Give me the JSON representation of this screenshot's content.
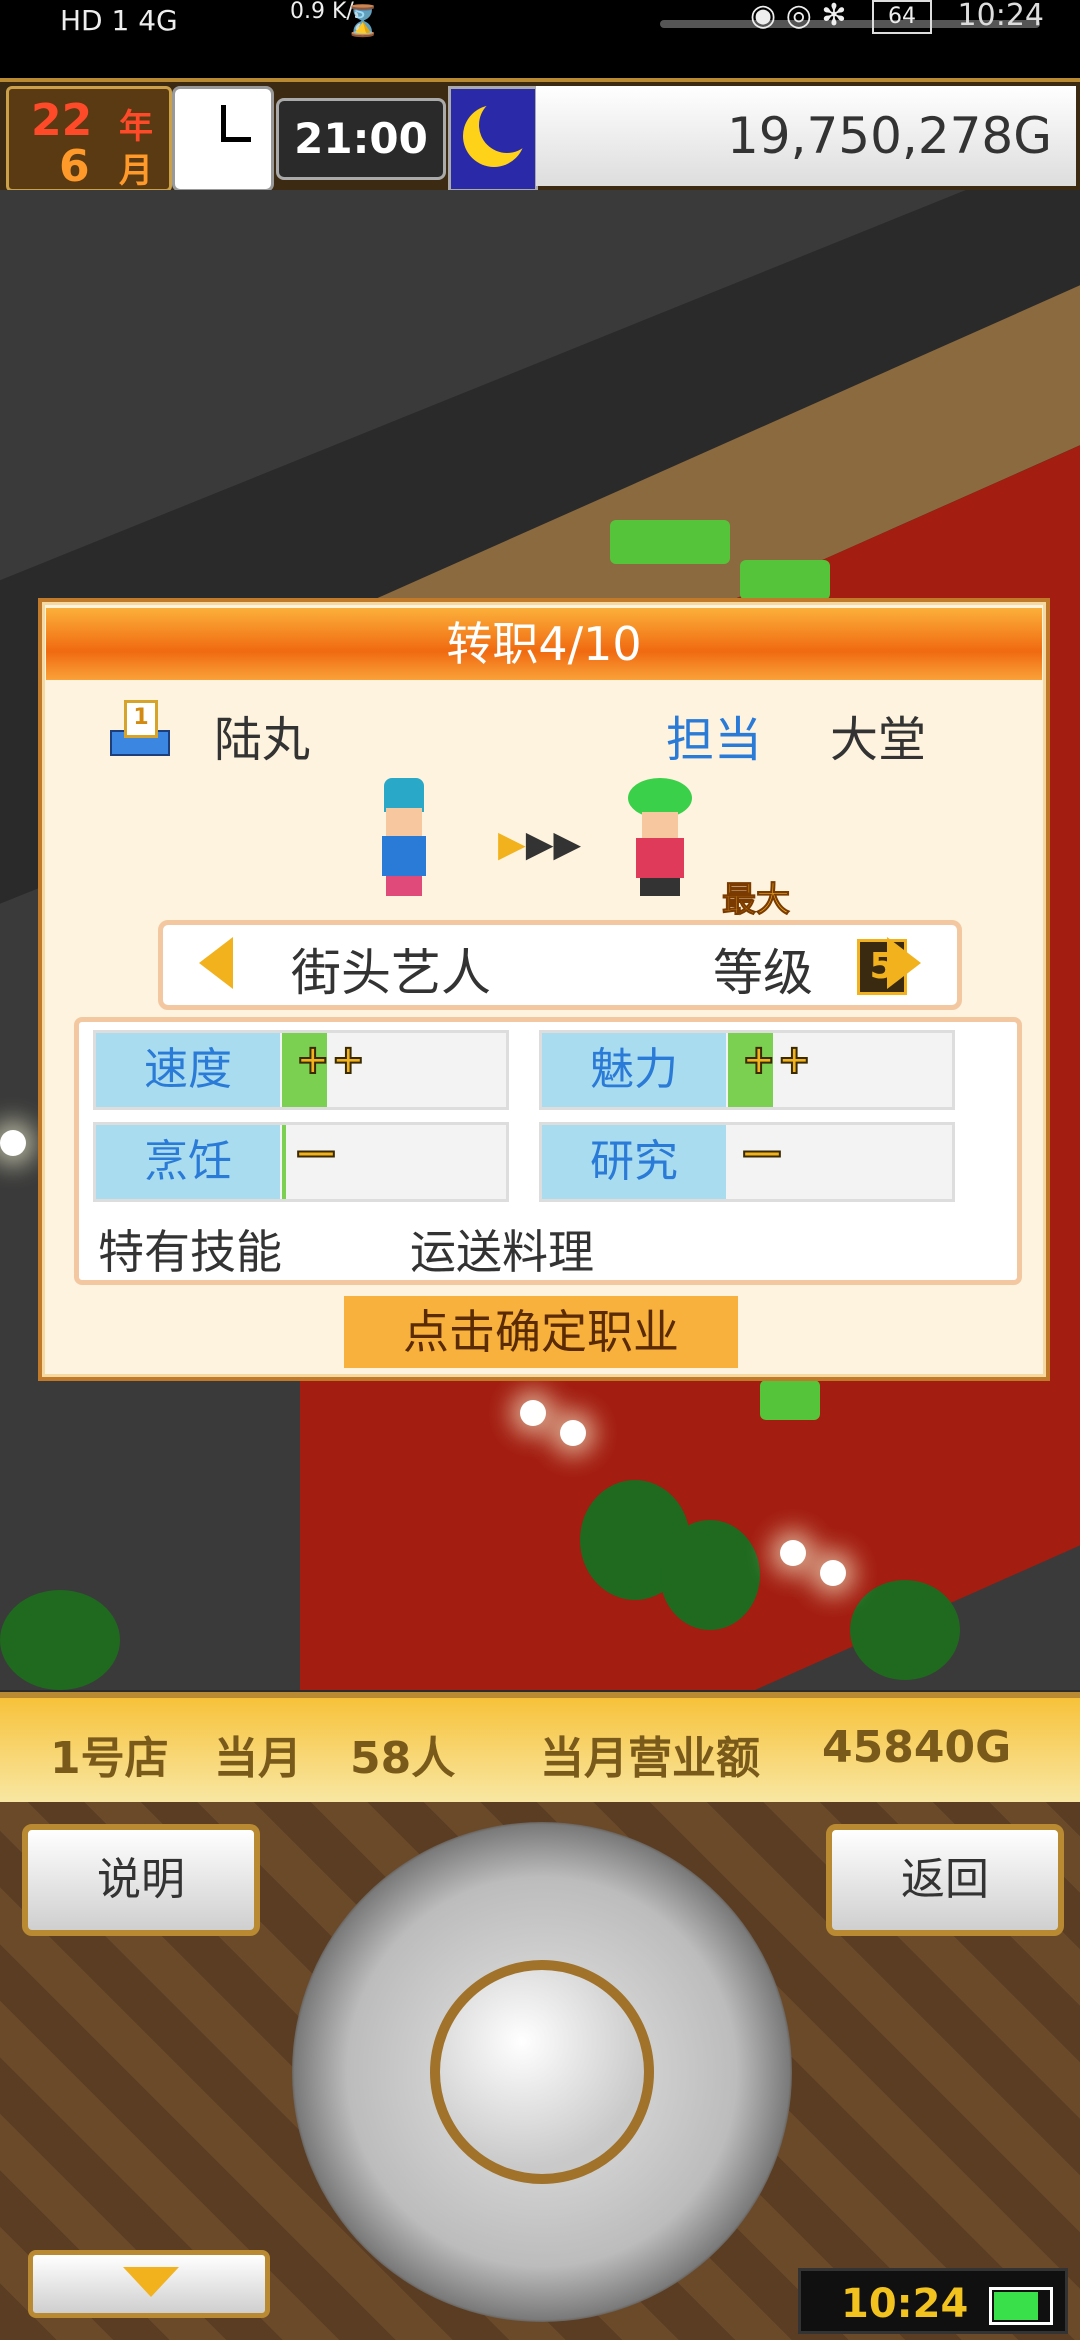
{
  "status_bar": {
    "network": "HD 1 4G",
    "speed": "0.9 K/s",
    "battery": "64",
    "time": "10:24"
  },
  "hud": {
    "year_num": "22",
    "year_unit": "年",
    "month_num": "6",
    "month_unit": "月",
    "time": "21:00",
    "money": "19,750,278G"
  },
  "dialog": {
    "title": "转职4/10",
    "staff_name": "陆丸",
    "role_label": "担当",
    "role_value": "大堂",
    "max_badge": "最大",
    "job_name": "街头艺人",
    "level_label": "等级",
    "level_value": "5",
    "stats": [
      {
        "label": "速度",
        "value": "++",
        "level": 0.25
      },
      {
        "label": "魅力",
        "value": "++",
        "level": 0.25
      },
      {
        "label": "烹饪",
        "value": "—",
        "level": 0.02
      },
      {
        "label": "研究",
        "value": "—",
        "level": 0
      }
    ],
    "skill_label": "特有技能",
    "skill_value": "运送料理",
    "confirm_label": "点击确定职业"
  },
  "info_strip": {
    "store": "1号店",
    "month_label": "当月",
    "customers": "58人",
    "sales_label": "当月营业额",
    "sales": "45840G"
  },
  "controls": {
    "help_label": "说明",
    "back_label": "返回",
    "clock": "10:24"
  }
}
